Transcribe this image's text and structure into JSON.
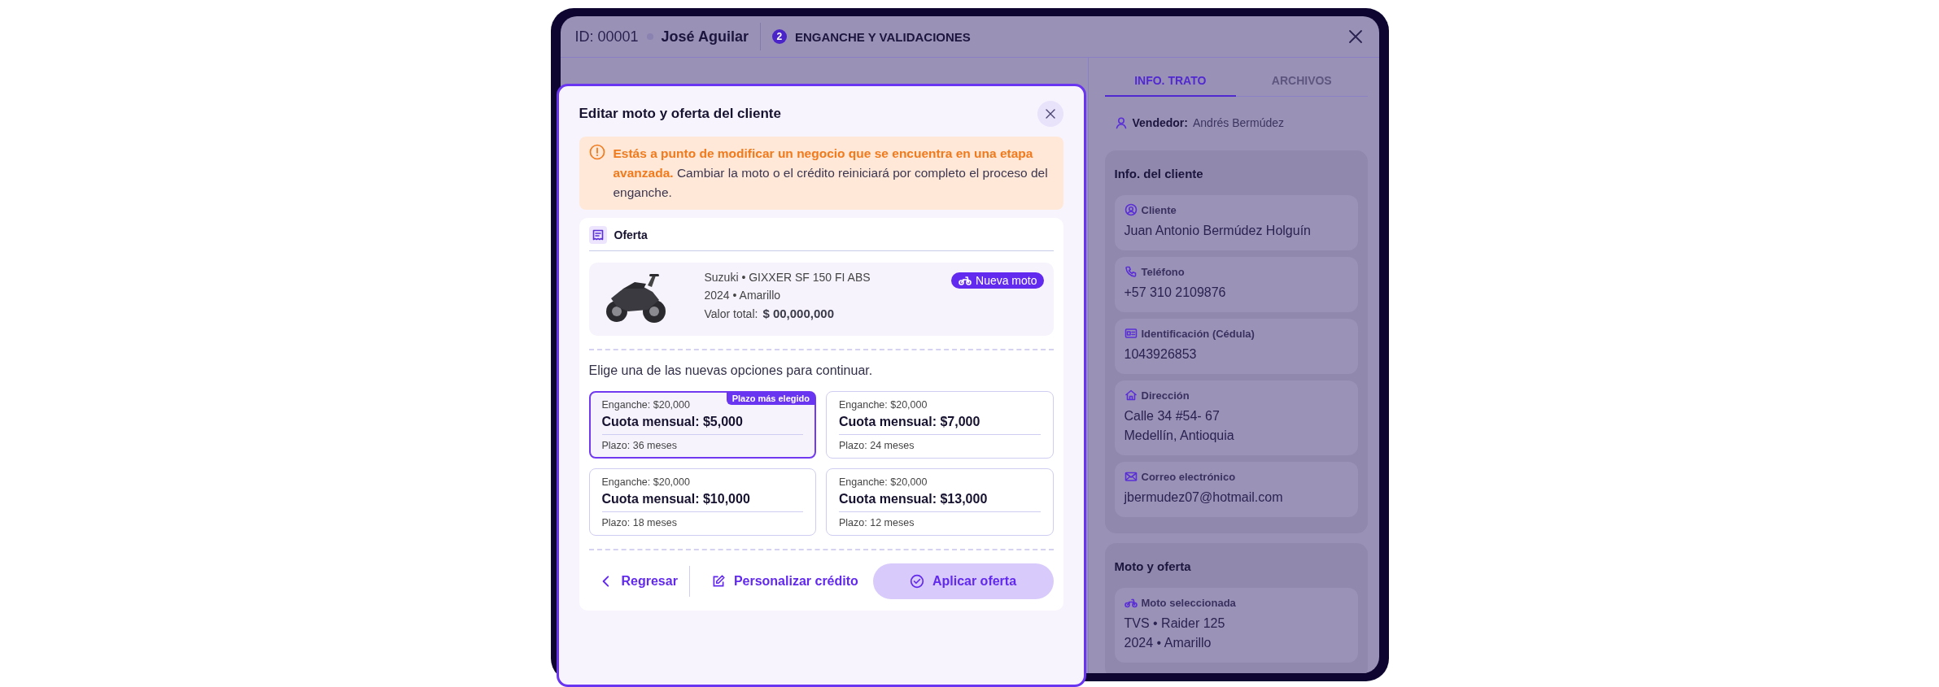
{
  "header": {
    "id": "ID: 00001",
    "client": "José Aguilar",
    "step_number": "2",
    "step": "ENGANCHE Y VALIDACIONES"
  },
  "tabs": [
    {
      "label": "INFO. TRATO",
      "selected": true
    },
    {
      "label": "ARCHIVOS",
      "selected": false
    }
  ],
  "seller": {
    "label": "Vendedor:",
    "name": "Andrés Bermúdez"
  },
  "sections": [
    {
      "title": "Info. del cliente",
      "fields": [
        {
          "kind": "client",
          "label": "Cliente",
          "lines": [
            "Juan Antonio Bermúdez Holguín"
          ]
        },
        {
          "kind": "phone",
          "label": "Teléfono",
          "lines": [
            "+57 310 2109876"
          ]
        },
        {
          "kind": "id",
          "label": "Identificación (Cédula)",
          "lines": [
            "1043926853"
          ]
        },
        {
          "kind": "address",
          "label": "Dirección",
          "lines": [
            "Calle 34 #54- 67",
            "Medellín, Antioquia"
          ]
        },
        {
          "kind": "email",
          "label": "Correo electrónico",
          "lines": [
            "jbermudez07@hotmail.com"
          ]
        }
      ]
    },
    {
      "title": "Moto y oferta",
      "fields": [
        {
          "kind": "moto",
          "label": "Moto seleccionada",
          "lines": [
            "TVS • Raider 125",
            "2024 • Amarillo"
          ]
        }
      ]
    }
  ],
  "modal": {
    "title": "Editar moto y oferta del cliente",
    "warning": "**Estás a punto de modificar un negocio que se encuentra en una etapa avanzada.** Cambiar la moto o el crédito reiniciará por completo el proceso del enganche.",
    "offer": {
      "title": "Oferta",
      "bike": {
        "line1": "Suzuki • GIXXER SF 150 FI ABS",
        "line2": "2024 • Amarillo",
        "total_label": "Valor total:",
        "total": "$ 00,000,000",
        "badge": "Nueva moto"
      },
      "prompt": "Elige una de las nuevas opciones para continuar.",
      "options": [
        {
          "down_payment": "Enganche: $20,000",
          "monthly": "Cuota mensual: $5,000",
          "term": "Plazo: 36 meses",
          "selected": true,
          "tag": "Plazo más elegido"
        },
        {
          "down_payment": "Enganche: $20,000",
          "monthly": "Cuota mensual: $7,000",
          "term": "Plazo: 24 meses",
          "selected": false
        },
        {
          "down_payment": "Enganche: $20,000",
          "monthly": "Cuota mensual: $10,000",
          "term": "Plazo: 18 meses",
          "selected": false
        },
        {
          "down_payment": "Enganche: $20,000",
          "monthly": "Cuota mensual: $13,000",
          "term": "Plazo: 12 meses",
          "selected": false
        }
      ]
    },
    "actions": [
      {
        "kind": "back",
        "label": "Regresar"
      },
      {
        "kind": "edit",
        "label": "Personalizar crédito"
      },
      {
        "kind": "apply",
        "label": "Aplicar oferta"
      }
    ]
  }
}
